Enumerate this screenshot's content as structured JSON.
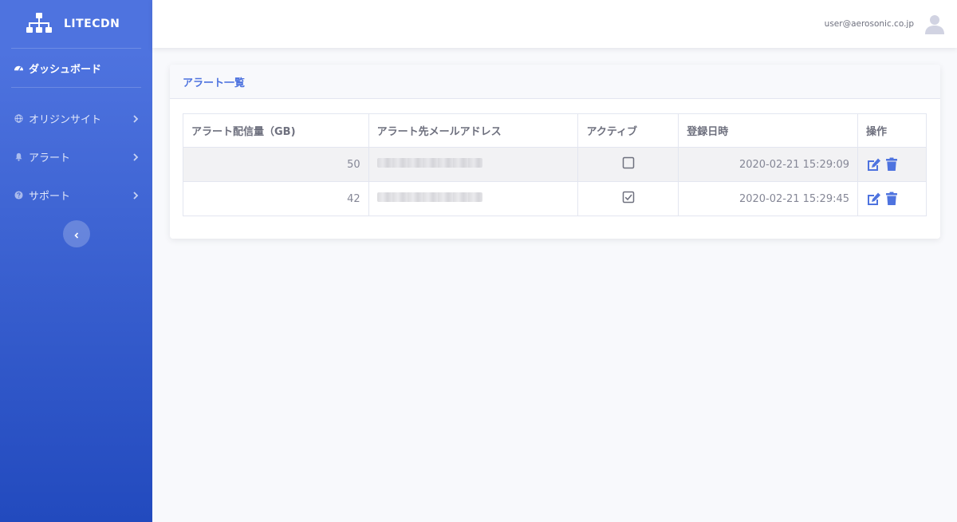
{
  "brand": {
    "name": "LITECDN"
  },
  "sidebar": {
    "dashboard": "ダッシュボード",
    "items": [
      {
        "label": "オリジンサイト",
        "icon": "globe-icon"
      },
      {
        "label": "アラート",
        "icon": "bell-icon"
      },
      {
        "label": "サポート",
        "icon": "question-circle-icon"
      }
    ]
  },
  "topbar": {
    "user_email": "user@aerosonic.co.jp"
  },
  "card": {
    "title": "アラート一覧",
    "columns": [
      "アラート配信量（GB)",
      "アラート先メールアドレス",
      "アクティブ",
      "登録日時",
      "操作"
    ],
    "rows": [
      {
        "amount": "50",
        "email": "",
        "active": false,
        "registered": "2020-02-21 15:29:09"
      },
      {
        "amount": "42",
        "email": "",
        "active": true,
        "registered": "2020-02-21 15:29:45"
      }
    ]
  },
  "colors": {
    "accent": "#4e73df",
    "sidebar_end": "#224abe",
    "text": "#858796"
  }
}
